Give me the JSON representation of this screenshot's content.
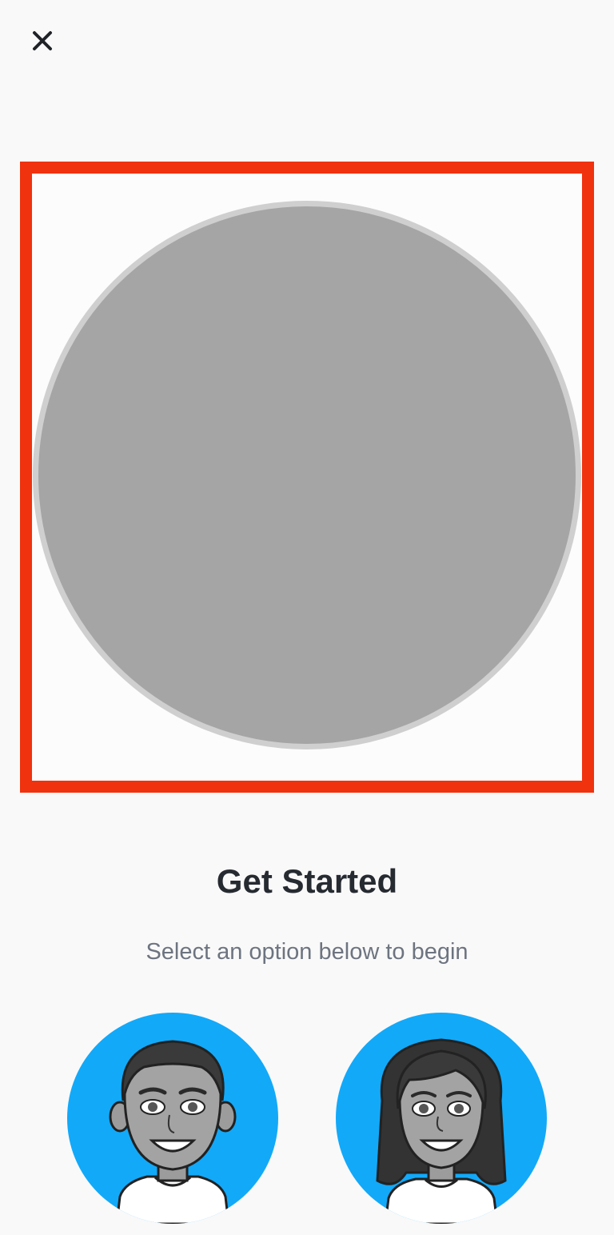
{
  "header": {
    "close_icon": "close-icon"
  },
  "preview": {
    "highlight_color": "#f0320f",
    "circle_color": "#a5a5a5"
  },
  "onboarding": {
    "title": "Get Started",
    "subtitle": "Select an option below to begin"
  },
  "options": [
    {
      "name": "male-avatar-option",
      "icon": "male-bitmoji-avatar",
      "background": "#12a9f9"
    },
    {
      "name": "female-avatar-option",
      "icon": "female-bitmoji-avatar",
      "background": "#12a9f9"
    }
  ]
}
